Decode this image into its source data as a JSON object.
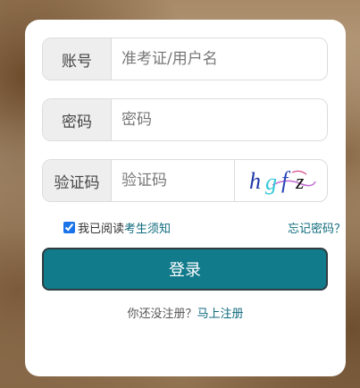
{
  "form": {
    "account": {
      "label": "账号",
      "placeholder": "准考证/用户名"
    },
    "password": {
      "label": "密码",
      "placeholder": "密码"
    },
    "captcha": {
      "label": "验证码",
      "placeholder": "验证码",
      "image_text": "hgfz"
    },
    "agree": {
      "prefix": "我已阅读",
      "link": "考生须知",
      "checked": true
    },
    "forgot": "忘记密码？",
    "submit": "登录",
    "register": {
      "prompt": "你还没注册？",
      "link": "马上注册"
    }
  },
  "colors": {
    "accent": "#117a8b",
    "link": "#0e6a7c"
  }
}
